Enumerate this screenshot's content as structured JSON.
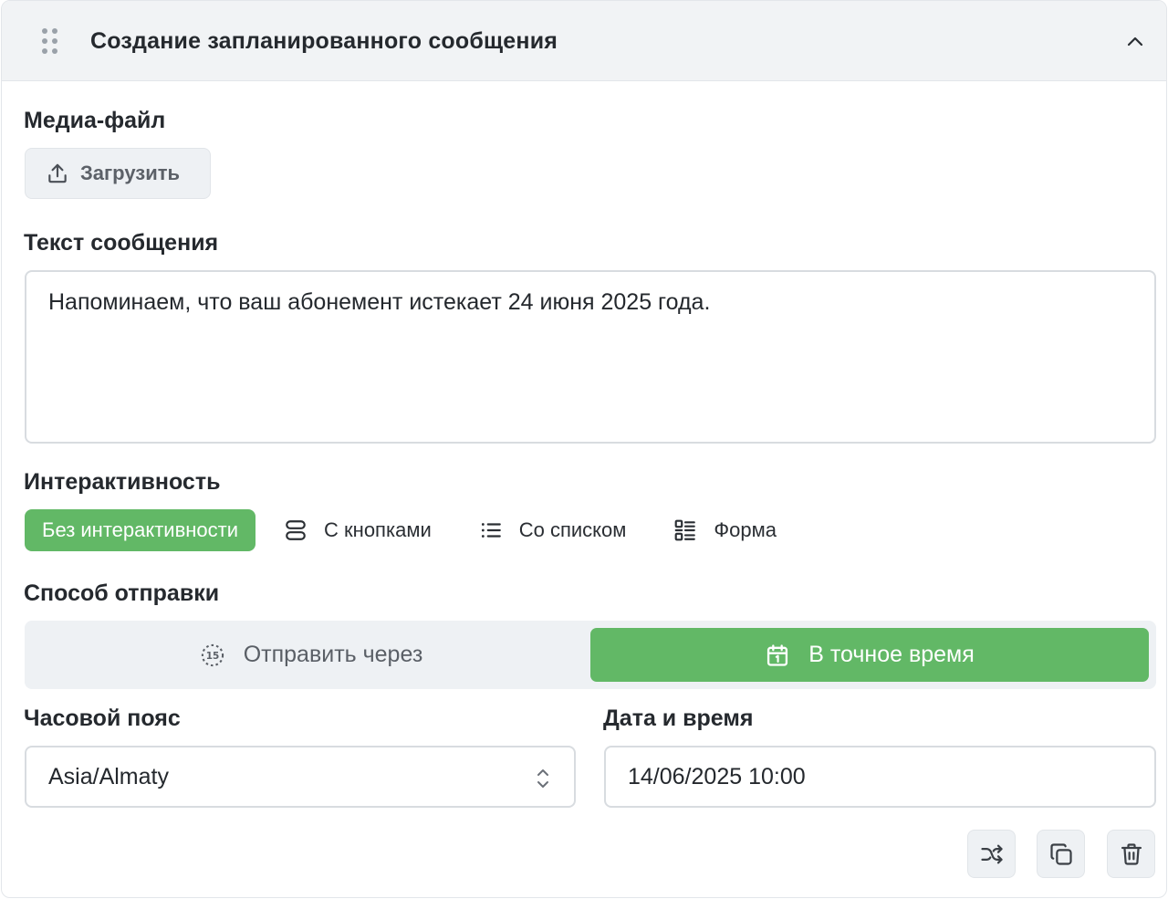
{
  "header": {
    "title": "Создание запланированного сообщения"
  },
  "media": {
    "label": "Медиа-файл",
    "upload_label": "Загрузить"
  },
  "message": {
    "label": "Текст сообщения",
    "value": "Напоминаем, что ваш абонемент истекает 24 июня 2025 года."
  },
  "interactivity": {
    "label": "Интерактивность",
    "options": [
      {
        "label": "Без интерактивности",
        "selected": true
      },
      {
        "label": "С кнопками",
        "icon": "buttons-icon"
      },
      {
        "label": "Со списком",
        "icon": "list-icon"
      },
      {
        "label": "Форма",
        "icon": "form-icon"
      }
    ]
  },
  "send_method": {
    "label": "Способ отправки",
    "options": [
      {
        "label": "Отправить через",
        "icon": "timer-15-icon"
      },
      {
        "label": "В точное время",
        "icon": "calendar-icon",
        "selected": true
      }
    ]
  },
  "timezone": {
    "label": "Часовой пояс",
    "value": "Asia/Almaty"
  },
  "datetime": {
    "label": "Дата и время",
    "value": "14/06/2025 10:00"
  },
  "colors": {
    "accent": "#62b866",
    "header_bg": "#f1f3f5"
  }
}
